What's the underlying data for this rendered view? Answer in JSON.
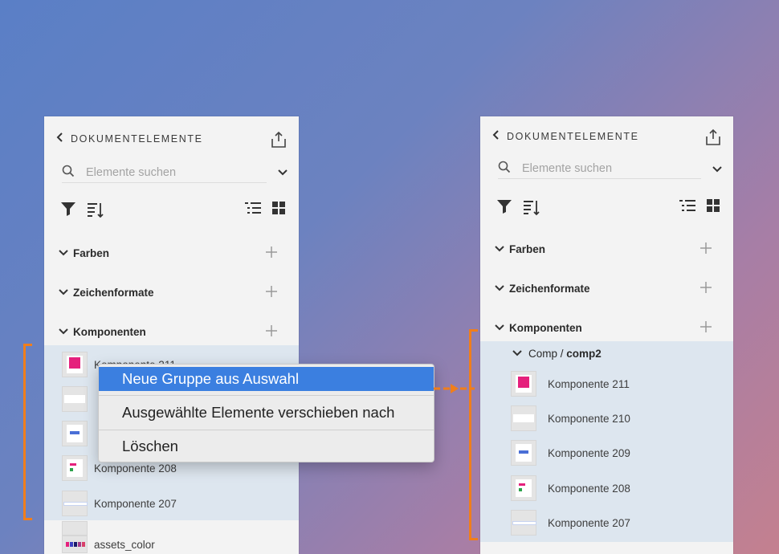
{
  "colors": {
    "accent": "#f07e1b",
    "menu_highlight": "#3b7fe0",
    "selection": "#dde6ef"
  },
  "left_panel": {
    "title": "DOKUMENTELEMENTE",
    "search_placeholder": "Elemente suchen",
    "sections": [
      {
        "label": "Farben"
      },
      {
        "label": "Zeichenformate"
      },
      {
        "label": "Komponenten"
      }
    ],
    "items": [
      "Komponente 211",
      "Komponente 208",
      "Komponente 207"
    ],
    "extra_item": "assets_color"
  },
  "context_menu": {
    "items": [
      "Neue Gruppe aus Auswahl",
      "Ausgewählte Elemente verschieben nach",
      "Löschen"
    ],
    "highlighted": "Neue Gruppe aus Auswahl"
  },
  "right_panel": {
    "title": "DOKUMENTELEMENTE",
    "search_placeholder": "Elemente suchen",
    "sections": [
      {
        "label": "Farben"
      },
      {
        "label": "Zeichenformate"
      },
      {
        "label": "Komponenten"
      }
    ],
    "group": {
      "prefix": "Comp / ",
      "name": "comp2"
    },
    "items": [
      "Komponente 211",
      "Komponente 210",
      "Komponente 209",
      "Komponente 208",
      "Komponente 207"
    ]
  }
}
